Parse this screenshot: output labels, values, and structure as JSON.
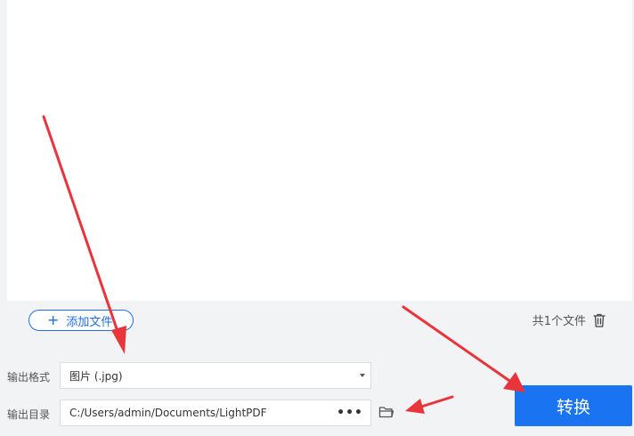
{
  "file_list": {
    "add_file_label": "添加文件",
    "file_count_text": "共1个文件",
    "icons": {
      "add": "plus-icon",
      "delete": "trash-icon"
    }
  },
  "output": {
    "format_label": "输出格式",
    "format_value": "图片 (.jpg)",
    "dir_label": "输出目录",
    "dir_value": "C:/Users/admin/Documents/LightPDF",
    "more_label": "•••",
    "icons": {
      "browse": "folder-icon",
      "format_dropdown": "chevron-down-icon"
    }
  },
  "actions": {
    "convert_label": "转换"
  },
  "colors": {
    "accent": "#1a73f0",
    "annotation_arrow": "#e8343a"
  }
}
